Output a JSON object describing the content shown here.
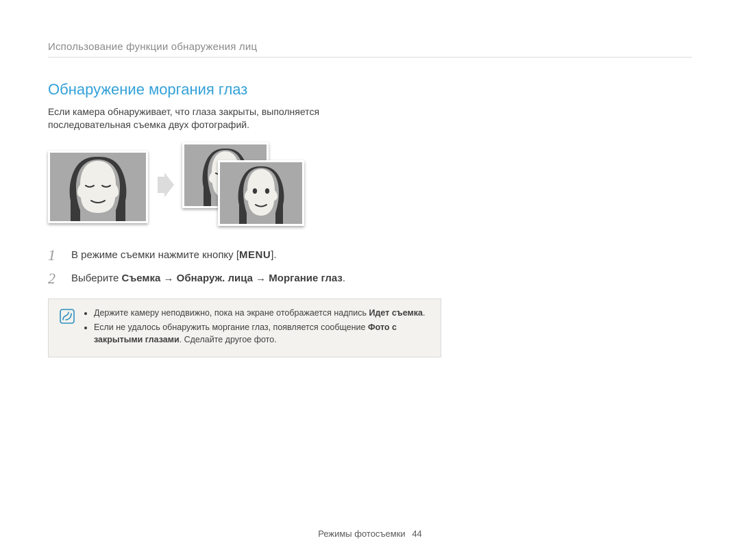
{
  "header": {
    "section": "Использование функции обнаружения лиц"
  },
  "title": "Обнаружение моргания глаз",
  "intro": "Если камера обнаруживает, что глаза закрыты, выполняется последовательная съемка двух фотографий.",
  "steps": {
    "s1": {
      "num": "1",
      "pre": "В режиме съемки нажмите кнопку [",
      "menu": "MENU",
      "post": "]."
    },
    "s2": {
      "num": "2",
      "pre": "Выберите ",
      "bold": "Съемка → Обнаруж. лица → Моргание глаз",
      "post": "."
    }
  },
  "notes": {
    "n1": {
      "pre": "Держите камеру неподвижно, пока на экране отображается надпись ",
      "bold": "Идет съемка",
      "post": "."
    },
    "n2": {
      "pre": "Если не удалось обнаружить моргание глаз, появляется сообщение ",
      "bold": "Фото с закрытыми глазами",
      "post": ". Сделайте другое фото."
    }
  },
  "footer": {
    "label": "Режимы фотосъемки",
    "page": "44"
  }
}
